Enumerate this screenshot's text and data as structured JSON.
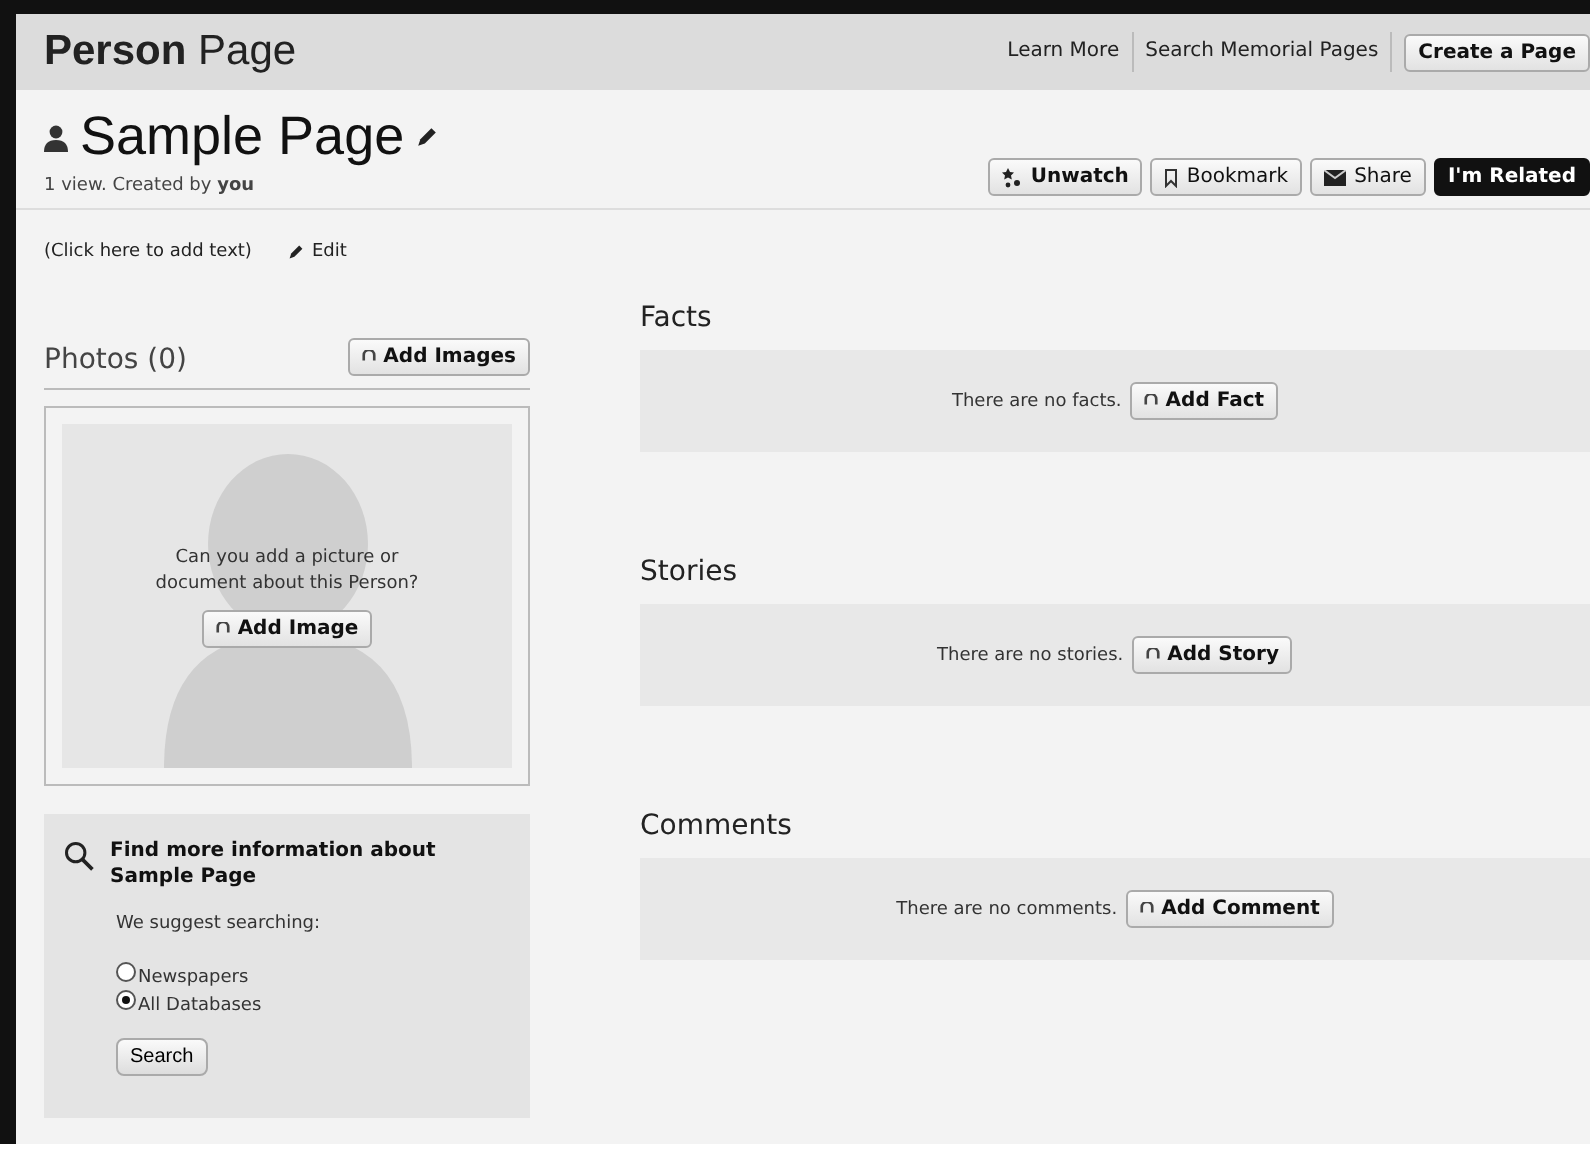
{
  "header": {
    "title_bold": "Person",
    "title_rest": "Page",
    "links": [
      {
        "label": "Learn More",
        "kind": "link"
      },
      {
        "label": "Search Memorial Pages",
        "kind": "link"
      },
      {
        "label": "Create a Page",
        "kind": "button"
      }
    ]
  },
  "page": {
    "name": "Sample Page",
    "meta": "1 view. Created by **you**",
    "actions": [
      {
        "label": "Unwatch",
        "kind": "watch"
      },
      {
        "label": "Bookmark",
        "kind": "bookmark"
      },
      {
        "label": "Share",
        "kind": "share"
      },
      {
        "label": "I'm Related",
        "kind": "primary"
      }
    ]
  },
  "description": {
    "text": "(Click here to add text)",
    "edit": "Edit"
  },
  "photos": {
    "title": "Photos (0)",
    "add_button": "Add Images",
    "prompt": "Can you add a picture or document about this Person?",
    "add_image": "Add Image"
  },
  "find_more": {
    "title": "Find more information about Sample Page",
    "suggest": "We suggest searching:",
    "options": [
      {
        "label": "Newspapers",
        "selected": false
      },
      {
        "label": "All Databases",
        "selected": true
      }
    ],
    "button": "Search"
  },
  "sections": [
    {
      "title": "Facts",
      "empty": "There are no facts.",
      "button": "Add Fact"
    },
    {
      "title": "Stories",
      "empty": "There are no stories.",
      "button": "Add Story"
    },
    {
      "title": "Comments",
      "empty": "There are no comments.",
      "button": "Add Comment"
    }
  ]
}
